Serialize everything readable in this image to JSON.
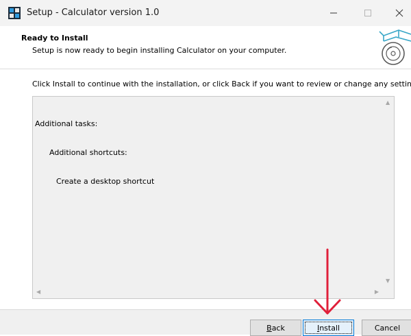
{
  "window": {
    "title": "Setup - Calculator version 1.0",
    "controls": [
      "minimize-icon",
      "maximize-icon",
      "close-icon"
    ]
  },
  "header": {
    "title": "Ready to Install",
    "subtitle": "Setup is now ready to begin installing Calculator on your computer.",
    "icon": "install-box-icon"
  },
  "body": {
    "instruction": "Click Install to continue with the installation, or click Back if you want to review or change any settings.",
    "memo": {
      "line1": "Additional tasks:",
      "line2": "Additional shortcuts:",
      "line3": "Create a desktop shortcut"
    }
  },
  "buttons": {
    "back": {
      "first": "B",
      "rest": "ack"
    },
    "install": {
      "first": "I",
      "rest": "nstall"
    },
    "cancel": "Cancel"
  },
  "annotation": {
    "icon": "red-down-arrow"
  },
  "colors": {
    "titlebar": "#f3f3f3",
    "footer": "#f0f0f0",
    "memo_background": "#f0f0f0",
    "default_button_border": "#0078d7",
    "annotation_arrow": "#e0203a"
  }
}
